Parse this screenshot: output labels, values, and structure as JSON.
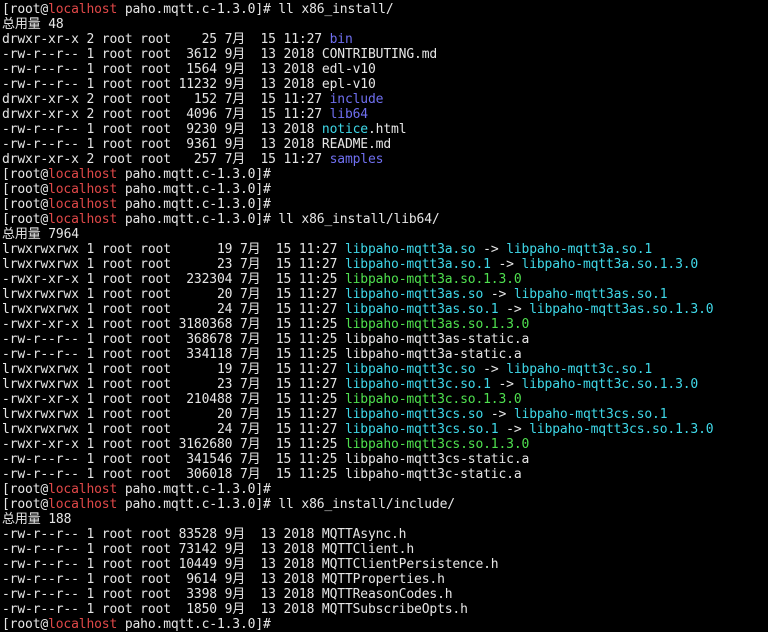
{
  "terminal": {
    "lines": [
      [
        {
          "t": "[root@",
          "s": "normal"
        },
        {
          "t": "localhost",
          "s": "host"
        },
        {
          "t": " paho.mqtt.c-1.3.0]# ll x86_install/",
          "s": "normal"
        }
      ],
      [
        {
          "t": "总用量 48",
          "s": "normal"
        }
      ],
      [
        {
          "t": "drwxr-xr-x 2 root root    25 7月  15 11:27 ",
          "s": "normal"
        },
        {
          "t": "bin",
          "s": "dir"
        }
      ],
      [
        {
          "t": "-rw-r--r-- 1 root root  3612 9月  13 2018 CONTRIBUTING.md",
          "s": "normal"
        }
      ],
      [
        {
          "t": "-rw-r--r-- 1 root root  1564 9月  13 2018 edl-v10",
          "s": "normal"
        }
      ],
      [
        {
          "t": "-rw-r--r-- 1 root root 11232 9月  13 2018 epl-v10",
          "s": "normal"
        }
      ],
      [
        {
          "t": "drwxr-xr-x 2 root root   152 7月  15 11:27 ",
          "s": "normal"
        },
        {
          "t": "include",
          "s": "dir"
        }
      ],
      [
        {
          "t": "drwxr-xr-x 2 root root  4096 7月  15 11:27 ",
          "s": "normal"
        },
        {
          "t": "lib64",
          "s": "dir"
        }
      ],
      [
        {
          "t": "-rw-r--r-- 1 root root  9230 9月  13 2018 ",
          "s": "normal"
        },
        {
          "t": "notice",
          "s": "link"
        },
        {
          "t": ".html",
          "s": "normal"
        }
      ],
      [
        {
          "t": "-rw-r--r-- 1 root root  9361 9月  13 2018 README.md",
          "s": "normal"
        }
      ],
      [
        {
          "t": "drwxr-xr-x 2 root root   257 7月  15 11:27 ",
          "s": "normal"
        },
        {
          "t": "samples",
          "s": "dir"
        }
      ],
      [
        {
          "t": "[root@",
          "s": "normal"
        },
        {
          "t": "localhost",
          "s": "host"
        },
        {
          "t": " paho.mqtt.c-1.3.0]#",
          "s": "normal"
        }
      ],
      [
        {
          "t": "[root@",
          "s": "normal"
        },
        {
          "t": "localhost",
          "s": "host"
        },
        {
          "t": " paho.mqtt.c-1.3.0]#",
          "s": "normal"
        }
      ],
      [
        {
          "t": "[root@",
          "s": "normal"
        },
        {
          "t": "localhost",
          "s": "host"
        },
        {
          "t": " paho.mqtt.c-1.3.0]#",
          "s": "normal"
        }
      ],
      [
        {
          "t": "[root@",
          "s": "normal"
        },
        {
          "t": "localhost",
          "s": "host"
        },
        {
          "t": " paho.mqtt.c-1.3.0]# ll x86_install/lib64/",
          "s": "normal"
        }
      ],
      [
        {
          "t": "总用量 7964",
          "s": "normal"
        }
      ],
      [
        {
          "t": "lrwxrwxrwx 1 root root      19 7月  15 11:27 ",
          "s": "normal"
        },
        {
          "t": "libpaho-mqtt3a.so",
          "s": "link"
        },
        {
          "t": " -> ",
          "s": "normal"
        },
        {
          "t": "libpaho-mqtt3a.so.1",
          "s": "link"
        }
      ],
      [
        {
          "t": "lrwxrwxrwx 1 root root      23 7月  15 11:27 ",
          "s": "normal"
        },
        {
          "t": "libpaho-mqtt3a.so.1",
          "s": "link"
        },
        {
          "t": " -> ",
          "s": "normal"
        },
        {
          "t": "libpaho-mqtt3a.so.1.3.0",
          "s": "link"
        }
      ],
      [
        {
          "t": "-rwxr-xr-x 1 root root  232304 7月  15 11:25 ",
          "s": "normal"
        },
        {
          "t": "libpaho-mqtt3a.so.1.3.0",
          "s": "exec"
        }
      ],
      [
        {
          "t": "lrwxrwxrwx 1 root root      20 7月  15 11:27 ",
          "s": "normal"
        },
        {
          "t": "libpaho-mqtt3as.so",
          "s": "link"
        },
        {
          "t": " -> ",
          "s": "normal"
        },
        {
          "t": "libpaho-mqtt3as.so.1",
          "s": "link"
        }
      ],
      [
        {
          "t": "lrwxrwxrwx 1 root root      24 7月  15 11:27 ",
          "s": "normal"
        },
        {
          "t": "libpaho-mqtt3as.so.1",
          "s": "link"
        },
        {
          "t": " -> ",
          "s": "normal"
        },
        {
          "t": "libpaho-mqtt3as.so.1.3.0",
          "s": "link"
        }
      ],
      [
        {
          "t": "-rwxr-xr-x 1 root root 3180368 7月  15 11:25 ",
          "s": "normal"
        },
        {
          "t": "libpaho-mqtt3as.so.1.3.0",
          "s": "exec"
        }
      ],
      [
        {
          "t": "-rw-r--r-- 1 root root  368678 7月  15 11:25 libpaho-mqtt3as-static.a",
          "s": "normal"
        }
      ],
      [
        {
          "t": "-rw-r--r-- 1 root root  334118 7月  15 11:25 libpaho-mqtt3a-static.a",
          "s": "normal"
        }
      ],
      [
        {
          "t": "lrwxrwxrwx 1 root root      19 7月  15 11:27 ",
          "s": "normal"
        },
        {
          "t": "libpaho-mqtt3c.so",
          "s": "link"
        },
        {
          "t": " -> ",
          "s": "normal"
        },
        {
          "t": "libpaho-mqtt3c.so.1",
          "s": "link"
        }
      ],
      [
        {
          "t": "lrwxrwxrwx 1 root root      23 7月  15 11:27 ",
          "s": "normal"
        },
        {
          "t": "libpaho-mqtt3c.so.1",
          "s": "link"
        },
        {
          "t": " -> ",
          "s": "normal"
        },
        {
          "t": "libpaho-mqtt3c.so.1.3.0",
          "s": "link"
        }
      ],
      [
        {
          "t": "-rwxr-xr-x 1 root root  210488 7月  15 11:25 ",
          "s": "normal"
        },
        {
          "t": "libpaho-mqtt3c.so.1.3.0",
          "s": "exec"
        }
      ],
      [
        {
          "t": "lrwxrwxrwx 1 root root      20 7月  15 11:27 ",
          "s": "normal"
        },
        {
          "t": "libpaho-mqtt3cs.so",
          "s": "link"
        },
        {
          "t": " -> ",
          "s": "normal"
        },
        {
          "t": "libpaho-mqtt3cs.so.1",
          "s": "link"
        }
      ],
      [
        {
          "t": "lrwxrwxrwx 1 root root      24 7月  15 11:27 ",
          "s": "normal"
        },
        {
          "t": "libpaho-mqtt3cs.so.1",
          "s": "link"
        },
        {
          "t": " -> ",
          "s": "normal"
        },
        {
          "t": "libpaho-mqtt3cs.so.1.3.0",
          "s": "link"
        }
      ],
      [
        {
          "t": "-rwxr-xr-x 1 root root 3162680 7月  15 11:25 ",
          "s": "normal"
        },
        {
          "t": "libpaho-mqtt3cs.so.1.3.0",
          "s": "exec"
        }
      ],
      [
        {
          "t": "-rw-r--r-- 1 root root  341546 7月  15 11:25 libpaho-mqtt3cs-static.a",
          "s": "normal"
        }
      ],
      [
        {
          "t": "-rw-r--r-- 1 root root  306018 7月  15 11:25 libpaho-mqtt3c-static.a",
          "s": "normal"
        }
      ],
      [
        {
          "t": "[root@",
          "s": "normal"
        },
        {
          "t": "localhost",
          "s": "host"
        },
        {
          "t": " paho.mqtt.c-1.3.0]#",
          "s": "normal"
        }
      ],
      [
        {
          "t": "[root@",
          "s": "normal"
        },
        {
          "t": "localhost",
          "s": "host"
        },
        {
          "t": " paho.mqtt.c-1.3.0]# ll x86_install/include/",
          "s": "normal"
        }
      ],
      [
        {
          "t": "总用量 188",
          "s": "normal"
        }
      ],
      [
        {
          "t": "-rw-r--r-- 1 root root 83528 9月  13 2018 MQTTAsync.h",
          "s": "normal"
        }
      ],
      [
        {
          "t": "-rw-r--r-- 1 root root 73142 9月  13 2018 MQTTClient.h",
          "s": "normal"
        }
      ],
      [
        {
          "t": "-rw-r--r-- 1 root root 10449 9月  13 2018 MQTTClientPersistence.h",
          "s": "normal"
        }
      ],
      [
        {
          "t": "-rw-r--r-- 1 root root  9614 9月  13 2018 MQTTProperties.h",
          "s": "normal"
        }
      ],
      [
        {
          "t": "-rw-r--r-- 1 root root  3398 9月  13 2018 MQTTReasonCodes.h",
          "s": "normal"
        }
      ],
      [
        {
          "t": "-rw-r--r-- 1 root root  1850 9月  13 2018 MQTTSubscribeOpts.h",
          "s": "normal"
        }
      ],
      [
        {
          "t": "[root@",
          "s": "normal"
        },
        {
          "t": "localhost",
          "s": "host"
        },
        {
          "t": " paho.mqtt.c-1.3.0]#",
          "s": "normal"
        }
      ]
    ]
  },
  "colors": {
    "background": "#000000",
    "text": "#e6e6e6",
    "hostname": "#e04848",
    "directory": "#6f6ff0",
    "symlink": "#3fd8e8",
    "executable": "#4fe04f"
  }
}
